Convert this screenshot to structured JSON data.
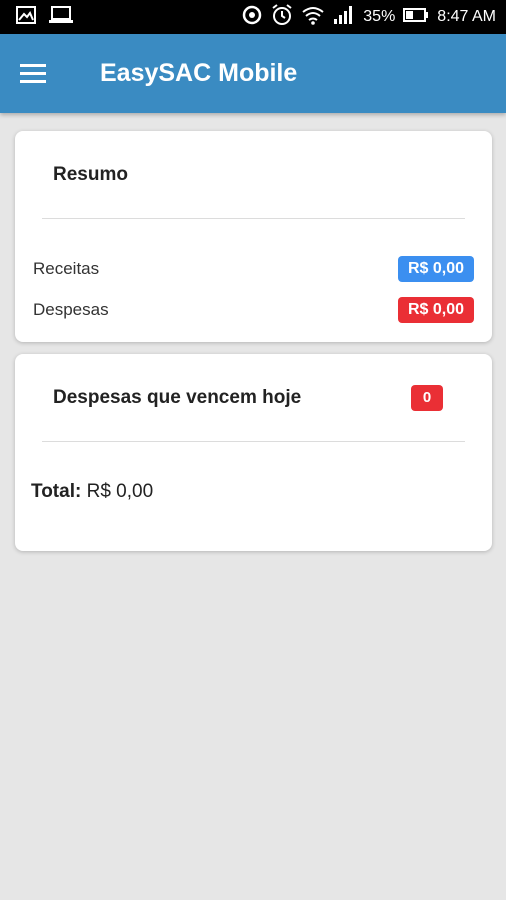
{
  "status_bar": {
    "battery_percent": "35%",
    "time": "8:47 AM",
    "left_icons": [
      "image-icon",
      "laptop-icon"
    ],
    "right_icons": [
      "sync-icon",
      "alarm-icon",
      "wifi-icon",
      "signal-icon",
      "battery-icon"
    ]
  },
  "app_bar": {
    "title": "EasySAC Mobile",
    "menu_icon": "menu-icon",
    "color": "#3a8bc2"
  },
  "resumo": {
    "title": "Resumo",
    "rows": [
      {
        "label": "Receitas",
        "value": "R$ 0,00",
        "color": "#3b8ff0"
      },
      {
        "label": "Despesas",
        "value": "R$ 0,00",
        "color": "#ea2f35"
      }
    ]
  },
  "vencimentos": {
    "title": "Despesas que vencem hoje",
    "count": "0",
    "total_label": "Total:",
    "total_value": "R$ 0,00"
  }
}
